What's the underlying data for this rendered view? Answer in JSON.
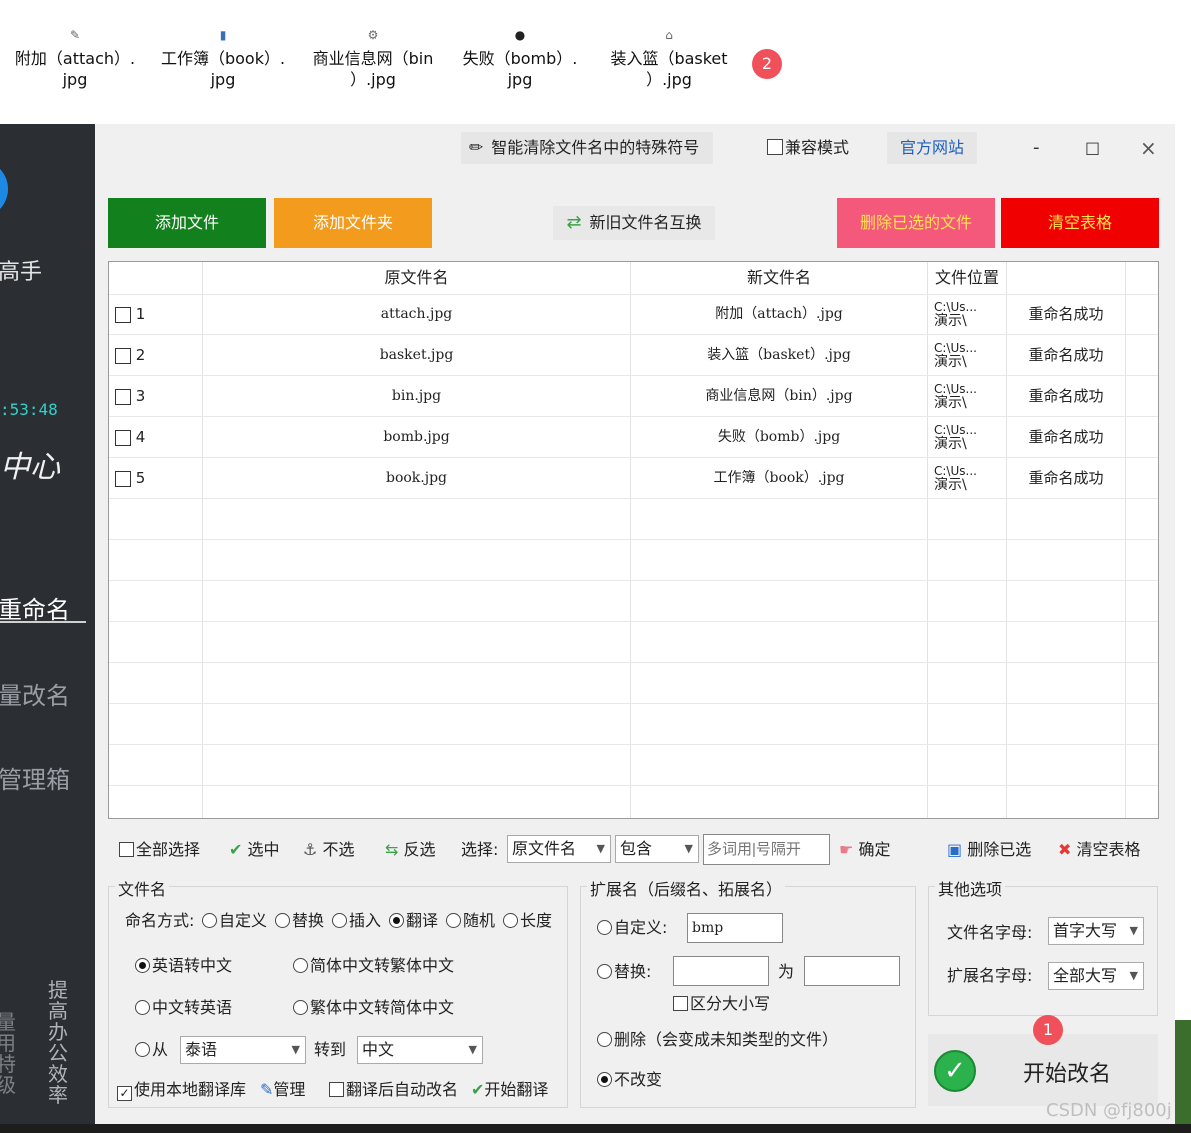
{
  "file_strip": {
    "items": [
      {
        "line1": "附加（attach）.",
        "line2": "jpg",
        "icon": "attach-file-icon"
      },
      {
        "line1": "工作簿（book）.",
        "line2": "jpg",
        "icon": "book-file-icon"
      },
      {
        "line1": "商业信息网（bin",
        "line2": "）.jpg",
        "icon": "bin-file-icon"
      },
      {
        "line1": "失败（bomb）.",
        "line2": "jpg",
        "icon": "bomb-file-icon"
      },
      {
        "line1": "装入篮（basket",
        "line2": "）.jpg",
        "icon": "basket-file-icon"
      }
    ],
    "badge": "2"
  },
  "sidebar": {
    "title_fragment": "高手",
    "time": ":53:48",
    "script_fragment": "中心",
    "nav": [
      "重命名",
      "量改名",
      "管理箱"
    ],
    "vertical_left": "量用特级",
    "vertical_right": "提高办公效率"
  },
  "titlebar": {
    "clean_label": "智能清除文件名中的特殊符号",
    "compat_label": "兼容模式",
    "website_label": "官方网站",
    "minimize": "-",
    "maximize": "□",
    "close": "×"
  },
  "actions": {
    "add_file": "添加文件",
    "add_folder": "添加文件夹",
    "swap": "新旧文件名互换",
    "delete_selected": "删除已选的文件",
    "clear_table": "清空表格"
  },
  "table": {
    "headers": [
      "原文件名",
      "新文件名",
      "文件位置"
    ],
    "rows": [
      {
        "num": "1",
        "orig": "attach.jpg",
        "new": "附加（attach）.jpg",
        "loc1": "C:\\Us...",
        "loc2": "演示\\",
        "status": "重命名成功"
      },
      {
        "num": "2",
        "orig": "basket.jpg",
        "new": "装入篮（basket）.jpg",
        "loc1": "C:\\Us...",
        "loc2": "演示\\",
        "status": "重命名成功"
      },
      {
        "num": "3",
        "orig": "bin.jpg",
        "new": "商业信息网（bin）.jpg",
        "loc1": "C:\\Us...",
        "loc2": "演示\\",
        "status": "重命名成功"
      },
      {
        "num": "4",
        "orig": "bomb.jpg",
        "new": "失败（bomb）.jpg",
        "loc1": "C:\\Us...",
        "loc2": "演示\\",
        "status": "重命名成功"
      },
      {
        "num": "5",
        "orig": "book.jpg",
        "new": "工作簿（book）.jpg",
        "loc1": "C:\\Us...",
        "loc2": "演示\\",
        "status": "重命名成功"
      }
    ]
  },
  "toolbar": {
    "select_all": "全部选择",
    "select": "选中",
    "deselect": "不选",
    "invert": "反选",
    "choose_label": "选择:",
    "field_value": "原文件名",
    "match_value": "包含",
    "keywords_placeholder": "多词用|号隔开",
    "confirm": "确定",
    "delete_selected": "删除已选",
    "clear_table": "清空表格"
  },
  "filename_group": {
    "title": "文件名",
    "mode_label": "命名方式:",
    "modes": [
      "自定义",
      "替换",
      "插入",
      "翻译",
      "随机",
      "长度"
    ],
    "selected_mode": "翻译",
    "en_to_zh": "英语转中文",
    "simp_to_trad": "简体中文转繁体中文",
    "zh_to_en": "中文转英语",
    "trad_to_simp": "繁体中文转简体中文",
    "from_label": "从",
    "from_value": "泰语",
    "to_label": "转到",
    "to_value": "中文",
    "local_lib": "使用本地翻译库",
    "manage": "管理",
    "auto_rename": "翻译后自动改名",
    "start_translate": "开始翻译"
  },
  "ext_group": {
    "title": "扩展名（后缀名、拓展名）",
    "custom_label": "自定义:",
    "custom_value": "bmp",
    "replace_label": "替换:",
    "to_label": "为",
    "case_label": "区分大小写",
    "delete_label": "删除（会变成未知类型的文件）",
    "nochange_label": "不改变"
  },
  "other_group": {
    "title": "其他选项",
    "name_case_label": "文件名字母:",
    "name_case_value": "首字大写",
    "ext_case_label": "扩展名字母:",
    "ext_case_value": "全部大写"
  },
  "start": {
    "label": "开始改名",
    "badge": "1"
  },
  "watermark": "CSDN @fj800j"
}
